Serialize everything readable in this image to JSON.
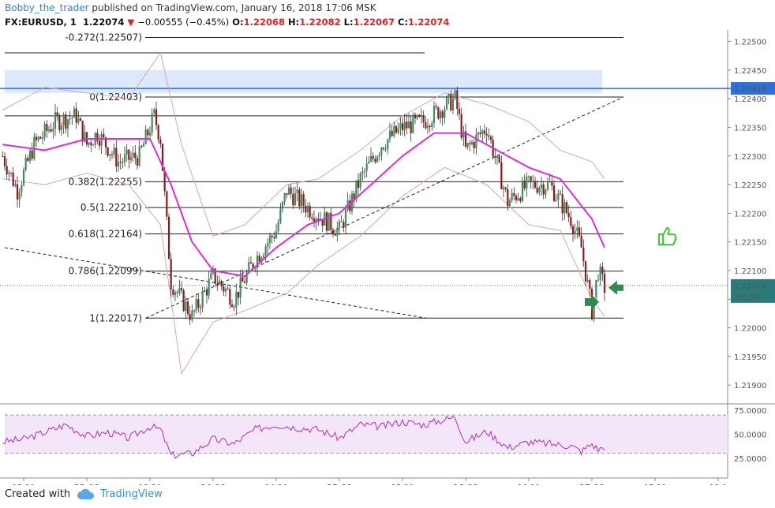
{
  "header": {
    "user": "Bobby_the_trader",
    "published": "published on TradingView.com, January 16, 2018 17:06 MSK",
    "symbol": "FX:EURUSD, 1",
    "last": "1.22074",
    "change": "−0.00555 (−0.45%)",
    "o_label": "O:",
    "o": "1.22068",
    "h_label": "H:",
    "h": "1.22082",
    "l_label": "L:",
    "l": "1.22067",
    "c_label": "C:",
    "c": "1.22074"
  },
  "footer": {
    "created": "Created with",
    "brand": "TradingView"
  },
  "colors": {
    "up": "#3a8f5a",
    "down": "#8b1a1a",
    "ma": "#e02bd9",
    "bb": "#d9a6a6",
    "hline": "#2f6fd6",
    "zone": "#dce8fb",
    "rsi": "#b02eb8",
    "rsi_band": "#f3e6f8",
    "arrow": "#2f8a4d",
    "thumb": "#39c939",
    "price_label_bg": "#2d7a7a"
  },
  "chart_data": {
    "type": "candlestick",
    "symbol": "FX:EURUSD",
    "timeframe": "1",
    "x_ticks": [
      "12:30",
      "13:00",
      "13:30",
      "14:00",
      "14:30",
      "15:00",
      "15:30",
      "16:00",
      "16:30",
      "17:00",
      "17:30",
      "18:0"
    ],
    "y_ticks": [
      "1.22500",
      "1.22450",
      "1.22400",
      "1.22350",
      "1.22300",
      "1.22250",
      "1.22200",
      "1.22150",
      "1.22100",
      "1.22050",
      "1.22000",
      "1.21950",
      "1.21900"
    ],
    "ylim": [
      1.2187,
      1.2252
    ],
    "price_path": [
      {
        "t": "12:20",
        "p": 1.223
      },
      {
        "t": "12:27",
        "p": 1.2224
      },
      {
        "t": "12:35",
        "p": 1.2232
      },
      {
        "t": "12:45",
        "p": 1.2236
      },
      {
        "t": "12:55",
        "p": 1.2237
      },
      {
        "t": "13:00",
        "p": 1.2232
      },
      {
        "t": "13:05",
        "p": 1.2234
      },
      {
        "t": "13:15",
        "p": 1.2229
      },
      {
        "t": "13:25",
        "p": 1.223
      },
      {
        "t": "13:32",
        "p": 1.2237
      },
      {
        "t": "13:35",
        "p": 1.2233
      },
      {
        "t": "13:40",
        "p": 1.2208
      },
      {
        "t": "13:50",
        "p": 1.2202
      },
      {
        "t": "14:00",
        "p": 1.2209
      },
      {
        "t": "14:10",
        "p": 1.2205
      },
      {
        "t": "14:20",
        "p": 1.2212
      },
      {
        "t": "14:30",
        "p": 1.2217
      },
      {
        "t": "14:35",
        "p": 1.2224
      },
      {
        "t": "14:45",
        "p": 1.2221
      },
      {
        "t": "15:00",
        "p": 1.2217
      },
      {
        "t": "15:10",
        "p": 1.2226
      },
      {
        "t": "15:20",
        "p": 1.2232
      },
      {
        "t": "15:30",
        "p": 1.2235
      },
      {
        "t": "15:40",
        "p": 1.2236
      },
      {
        "t": "15:55",
        "p": 1.224
      },
      {
        "t": "16:00",
        "p": 1.2231
      },
      {
        "t": "16:10",
        "p": 1.2235
      },
      {
        "t": "16:20",
        "p": 1.2222
      },
      {
        "t": "16:30",
        "p": 1.2225
      },
      {
        "t": "16:40",
        "p": 1.2225
      },
      {
        "t": "16:50",
        "p": 1.2219
      },
      {
        "t": "16:55",
        "p": 1.2214
      },
      {
        "t": "17:00",
        "p": 1.2203
      },
      {
        "t": "17:03",
        "p": 1.221
      },
      {
        "t": "17:06",
        "p": 1.2207
      }
    ],
    "moving_average": [
      {
        "t": "12:20",
        "p": 1.2232
      },
      {
        "t": "12:40",
        "p": 1.2231
      },
      {
        "t": "13:00",
        "p": 1.2233
      },
      {
        "t": "13:30",
        "p": 1.2233
      },
      {
        "t": "13:40",
        "p": 1.2225
      },
      {
        "t": "13:50",
        "p": 1.2215
      },
      {
        "t": "14:00",
        "p": 1.221
      },
      {
        "t": "14:15",
        "p": 1.2209
      },
      {
        "t": "14:30",
        "p": 1.2214
      },
      {
        "t": "14:45",
        "p": 1.2218
      },
      {
        "t": "15:00",
        "p": 1.222
      },
      {
        "t": "15:15",
        "p": 1.2225
      },
      {
        "t": "15:30",
        "p": 1.223
      },
      {
        "t": "15:45",
        "p": 1.2234
      },
      {
        "t": "16:00",
        "p": 1.2234
      },
      {
        "t": "16:15",
        "p": 1.2231
      },
      {
        "t": "16:30",
        "p": 1.2228
      },
      {
        "t": "16:45",
        "p": 1.2226
      },
      {
        "t": "17:00",
        "p": 1.2219
      },
      {
        "t": "17:06",
        "p": 1.2214
      }
    ],
    "bollinger_upper": [
      {
        "t": "12:20",
        "p": 1.2238
      },
      {
        "t": "12:40",
        "p": 1.2242
      },
      {
        "t": "13:00",
        "p": 1.2241
      },
      {
        "t": "13:20",
        "p": 1.224
      },
      {
        "t": "13:35",
        "p": 1.2248
      },
      {
        "t": "13:45",
        "p": 1.2232
      },
      {
        "t": "14:00",
        "p": 1.2216
      },
      {
        "t": "14:15",
        "p": 1.2218
      },
      {
        "t": "14:35",
        "p": 1.2225
      },
      {
        "t": "14:50",
        "p": 1.2226
      },
      {
        "t": "15:10",
        "p": 1.2231
      },
      {
        "t": "15:30",
        "p": 1.2237
      },
      {
        "t": "15:50",
        "p": 1.2241
      },
      {
        "t": "16:10",
        "p": 1.2239
      },
      {
        "t": "16:30",
        "p": 1.2236
      },
      {
        "t": "16:45",
        "p": 1.2231
      },
      {
        "t": "17:00",
        "p": 1.2229
      },
      {
        "t": "17:06",
        "p": 1.2226
      }
    ],
    "bollinger_lower": [
      {
        "t": "12:20",
        "p": 1.2226
      },
      {
        "t": "12:40",
        "p": 1.2225
      },
      {
        "t": "13:00",
        "p": 1.2227
      },
      {
        "t": "13:20",
        "p": 1.2225
      },
      {
        "t": "13:35",
        "p": 1.2218
      },
      {
        "t": "13:45",
        "p": 1.2192
      },
      {
        "t": "14:00",
        "p": 1.2201
      },
      {
        "t": "14:15",
        "p": 1.2203
      },
      {
        "t": "14:35",
        "p": 1.2206
      },
      {
        "t": "14:50",
        "p": 1.2211
      },
      {
        "t": "15:10",
        "p": 1.2216
      },
      {
        "t": "15:30",
        "p": 1.2223
      },
      {
        "t": "15:50",
        "p": 1.2228
      },
      {
        "t": "16:10",
        "p": 1.2225
      },
      {
        "t": "16:30",
        "p": 1.2218
      },
      {
        "t": "16:45",
        "p": 1.2217
      },
      {
        "t": "17:00",
        "p": 1.2205
      },
      {
        "t": "17:06",
        "p": 1.2202
      }
    ],
    "fibonacci_levels": [
      {
        "ratio": "-0.272",
        "price": "1.22507",
        "label": "-0.272(1.22507)"
      },
      {
        "ratio": "0",
        "price": "1.22403",
        "label": "0(1.22403)"
      },
      {
        "ratio": "0.382",
        "price": "1.22255",
        "label": "0.382(1.22255)"
      },
      {
        "ratio": "0.5",
        "price": "1.22210",
        "label": "0.5(1.22210)"
      },
      {
        "ratio": "0.618",
        "price": "1.22164",
        "label": "0.618(1.22164)"
      },
      {
        "ratio": "0.786",
        "price": "1.22099",
        "label": "0.786(1.22099)"
      },
      {
        "ratio": "1",
        "price": "1.22017",
        "label": "1(1.22017)"
      }
    ],
    "horizontal_line": {
      "price": 1.22418,
      "label": "1.22418"
    },
    "resistance_zone": [
      1.2241,
      1.2245
    ],
    "current_price": {
      "price": 1.22074,
      "label": "1.22074",
      "countdown": "00:36"
    },
    "rsi": {
      "y_ticks": [
        "75.0000",
        "50.0000",
        "25.0000"
      ],
      "ylim": [
        15,
        80
      ],
      "band": [
        30,
        70
      ],
      "values": [
        {
          "t": "12:20",
          "v": 42
        },
        {
          "t": "12:30",
          "v": 45
        },
        {
          "t": "12:40",
          "v": 52
        },
        {
          "t": "12:50",
          "v": 60
        },
        {
          "t": "13:00",
          "v": 48
        },
        {
          "t": "13:10",
          "v": 52
        },
        {
          "t": "13:20",
          "v": 46
        },
        {
          "t": "13:30",
          "v": 58
        },
        {
          "t": "13:35",
          "v": 55
        },
        {
          "t": "13:40",
          "v": 28
        },
        {
          "t": "13:50",
          "v": 30
        },
        {
          "t": "14:00",
          "v": 45
        },
        {
          "t": "14:10",
          "v": 40
        },
        {
          "t": "14:20",
          "v": 55
        },
        {
          "t": "14:30",
          "v": 60
        },
        {
          "t": "14:40",
          "v": 57
        },
        {
          "t": "14:50",
          "v": 55
        },
        {
          "t": "15:00",
          "v": 46
        },
        {
          "t": "15:10",
          "v": 60
        },
        {
          "t": "15:20",
          "v": 58
        },
        {
          "t": "15:30",
          "v": 63
        },
        {
          "t": "15:40",
          "v": 60
        },
        {
          "t": "15:55",
          "v": 68
        },
        {
          "t": "16:00",
          "v": 42
        },
        {
          "t": "16:10",
          "v": 53
        },
        {
          "t": "16:20",
          "v": 36
        },
        {
          "t": "16:30",
          "v": 42
        },
        {
          "t": "16:40",
          "v": 40
        },
        {
          "t": "16:50",
          "v": 38
        },
        {
          "t": "16:55",
          "v": 32
        },
        {
          "t": "17:00",
          "v": 40
        },
        {
          "t": "17:03",
          "v": 34
        },
        {
          "t": "17:06",
          "v": 37
        }
      ]
    }
  }
}
